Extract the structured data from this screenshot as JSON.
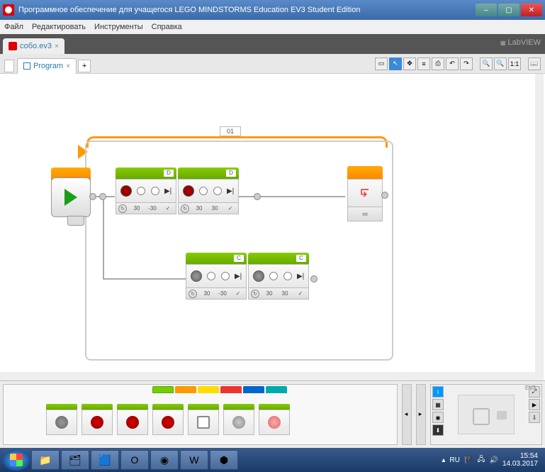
{
  "window": {
    "title": "Программное обеспечение для учащегося LEGO MINDSTORMS Education EV3 Student Edition",
    "min": "–",
    "max": "▢",
    "close": "✕"
  },
  "menubar": {
    "file": "Файл",
    "edit": "Редактировать",
    "tools": "Инструменты",
    "help": "Справка"
  },
  "file_tab": {
    "name": "собо.ev3",
    "close": "×"
  },
  "labview": "LabVIEW",
  "program_tab": {
    "name": "Program",
    "close": "×",
    "add": "+"
  },
  "toolbar": {
    "btn1": "▭",
    "btn2": "↖",
    "btn3": "✥",
    "btn4": "≡",
    "btn5": "⎙",
    "btn6": "↶",
    "btn7": "↷",
    "btn8": "🔍",
    "btn9": "🔍",
    "btn10": "1:1",
    "btn11": "📖"
  },
  "loop": {
    "label": "01",
    "infinity": "∞"
  },
  "blocks": {
    "d1": {
      "port": "D",
      "v1": "30",
      "v2": "-30",
      "v3": "✓"
    },
    "d2": {
      "port": "D",
      "v1": "30",
      "v2": "30",
      "v3": "✓"
    },
    "c1": {
      "port": "C",
      "v1": "30",
      "v2": "-30",
      "v3": "✓"
    },
    "c2": {
      "port": "C",
      "v1": "30",
      "v2": "30",
      "v3": "✓"
    }
  },
  "palette": {
    "collapse": "▸",
    "expand": "◂"
  },
  "brick": {
    "ev3": "EV3"
  },
  "taskbar": {
    "lang": "RU",
    "time": "15:54",
    "date": "14.03.2017"
  }
}
